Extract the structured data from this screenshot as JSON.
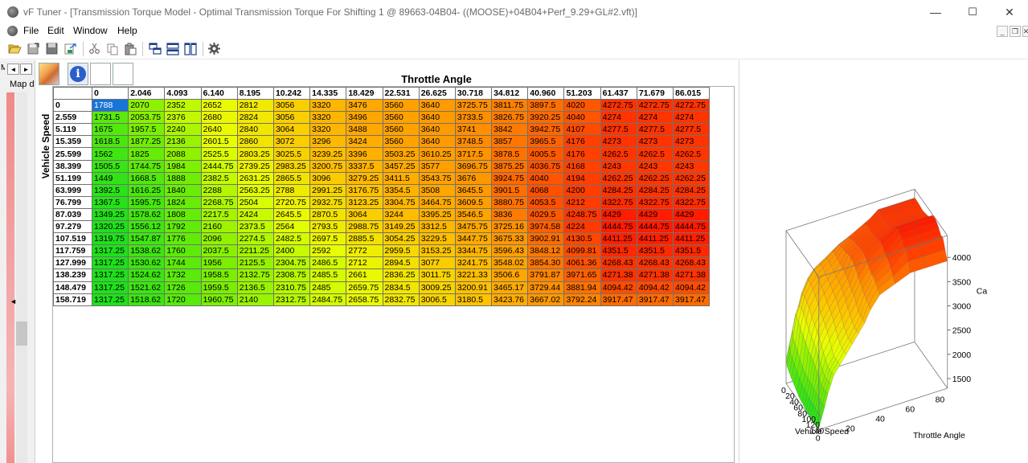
{
  "window": {
    "title": "vF Tuner  - [Transmission Torque Model - Optimal Transmission Torque For Shifting 1 @ 89663-04B04- ((MOOSE)+04B04+Perf_9.29+GL#2.vft)]",
    "minimize": "—",
    "maximize": "☐",
    "close": "✕"
  },
  "menu": {
    "items": [
      "File",
      "Edit",
      "Window",
      "Help"
    ],
    "mdi_minimize": "_",
    "mdi_restore": "❐",
    "mdi_close": "✕"
  },
  "sidebar": {
    "stub": "M",
    "label": "Map d",
    "left_arrow": "◄",
    "right_arrow": "►",
    "marker": "◄"
  },
  "grid": {
    "title": "Throttle Angle",
    "ylabel": "Vehicle Speed",
    "columns": [
      "0",
      "2.046",
      "4.093",
      "6.140",
      "8.195",
      "10.242",
      "14.335",
      "18.429",
      "22.531",
      "26.625",
      "30.718",
      "34.812",
      "40.960",
      "51.203",
      "61.437",
      "71.679",
      "86.015"
    ],
    "rows": [
      {
        "label": "0",
        "values": [
          "1788",
          "2070",
          "2352",
          "2652",
          "2812",
          "3056",
          "3320",
          "3476",
          "3560",
          "3640",
          "3725.75",
          "3811.75",
          "3897.5",
          "4020",
          "4272.75",
          "4272.75",
          "4272.75"
        ]
      },
      {
        "label": "2.559",
        "values": [
          "1731.5",
          "2053.75",
          "2376",
          "2680",
          "2824",
          "3056",
          "3320",
          "3496",
          "3560",
          "3640",
          "3733.5",
          "3826.75",
          "3920.25",
          "4040",
          "4274",
          "4274",
          "4274"
        ]
      },
      {
        "label": "5.119",
        "values": [
          "1675",
          "1957.5",
          "2240",
          "2640",
          "2840",
          "3064",
          "3320",
          "3488",
          "3560",
          "3640",
          "3741",
          "3842",
          "3942.75",
          "4107",
          "4277.5",
          "4277.5",
          "4277.5"
        ]
      },
      {
        "label": "15.359",
        "values": [
          "1618.5",
          "1877.25",
          "2136",
          "2601.5",
          "2860",
          "3072",
          "3296",
          "3424",
          "3560",
          "3640",
          "3748.5",
          "3857",
          "3965.5",
          "4176",
          "4273",
          "4273",
          "4273"
        ]
      },
      {
        "label": "25.599",
        "values": [
          "1562",
          "1825",
          "2088",
          "2525.5",
          "2803.25",
          "3025.5",
          "3239.25",
          "3396",
          "3503.25",
          "3610.25",
          "3717.5",
          "3878.5",
          "4005.5",
          "4176",
          "4262.5",
          "4262.5",
          "4262.5"
        ]
      },
      {
        "label": "38.399",
        "values": [
          "1505.5",
          "1744.75",
          "1984",
          "2444.75",
          "2739.25",
          "2983.25",
          "3200.75",
          "3337.5",
          "3457.25",
          "3577",
          "3696.75",
          "3875.25",
          "4036.75",
          "4168",
          "4243",
          "4243",
          "4243"
        ]
      },
      {
        "label": "51.199",
        "values": [
          "1449",
          "1668.5",
          "1888",
          "2382.5",
          "2631.25",
          "2865.5",
          "3096",
          "3279.25",
          "3411.5",
          "3543.75",
          "3676",
          "3924.75",
          "4040",
          "4194",
          "4262.25",
          "4262.25",
          "4262.25"
        ]
      },
      {
        "label": "63.999",
        "values": [
          "1392.5",
          "1616.25",
          "1840",
          "2288",
          "2563.25",
          "2788",
          "2991.25",
          "3176.75",
          "3354.5",
          "3508",
          "3645.5",
          "3901.5",
          "4068",
          "4200",
          "4284.25",
          "4284.25",
          "4284.25"
        ]
      },
      {
        "label": "76.799",
        "values": [
          "1367.5",
          "1595.75",
          "1824",
          "2268.75",
          "2504",
          "2720.75",
          "2932.75",
          "3123.25",
          "3304.75",
          "3464.75",
          "3609.5",
          "3880.75",
          "4053.5",
          "4212",
          "4322.75",
          "4322.75",
          "4322.75"
        ]
      },
      {
        "label": "87.039",
        "values": [
          "1349.25",
          "1578.62",
          "1808",
          "2217.5",
          "2424",
          "2645.5",
          "2870.5",
          "3064",
          "3244",
          "3395.25",
          "3546.5",
          "3836",
          "4029.5",
          "4248.75",
          "4429",
          "4429",
          "4429"
        ]
      },
      {
        "label": "97.279",
        "values": [
          "1320.25",
          "1556.12",
          "1792",
          "2160",
          "2373.5",
          "2564",
          "2793.5",
          "2988.75",
          "3149.25",
          "3312.5",
          "3475.75",
          "3725.16",
          "3974.58",
          "4224",
          "4444.75",
          "4444.75",
          "4444.75"
        ]
      },
      {
        "label": "107.519",
        "values": [
          "1319.75",
          "1547.87",
          "1776",
          "2096",
          "2274.5",
          "2482.5",
          "2697.5",
          "2885.5",
          "3054.25",
          "3229.5",
          "3447.75",
          "3675.33",
          "3902.91",
          "4130.5",
          "4411.25",
          "4411.25",
          "4411.25"
        ]
      },
      {
        "label": "117.759",
        "values": [
          "1317.25",
          "1538.62",
          "1760",
          "2037.5",
          "2211.25",
          "2400",
          "2592",
          "2772",
          "2959.5",
          "3153.25",
          "3344.75",
          "3596.43",
          "3848.12",
          "4099.81",
          "4351.5",
          "4351.5",
          "4351.5"
        ]
      },
      {
        "label": "127.999",
        "values": [
          "1317.25",
          "1530.62",
          "1744",
          "1956",
          "2125.5",
          "2304.75",
          "2486.5",
          "2712",
          "2894.5",
          "3077",
          "3241.75",
          "3548.02",
          "3854.30",
          "4061.36",
          "4268.43",
          "4268.43",
          "4268.43"
        ]
      },
      {
        "label": "138.239",
        "values": [
          "1317.25",
          "1524.62",
          "1732",
          "1958.5",
          "2132.75",
          "2308.75",
          "2485.5",
          "2661",
          "2836.25",
          "3011.75",
          "3221.33",
          "3506.6",
          "3791.87",
          "3971.65",
          "4271.38",
          "4271.38",
          "4271.38"
        ]
      },
      {
        "label": "148.479",
        "values": [
          "1317.25",
          "1521.62",
          "1726",
          "1959.5",
          "2136.5",
          "2310.75",
          "2485",
          "2659.75",
          "2834.5",
          "3009.25",
          "3200.91",
          "3465.17",
          "3729.44",
          "3881.94",
          "4094.42",
          "4094.42",
          "4094.42"
        ]
      },
      {
        "label": "158.719",
        "values": [
          "1317.25",
          "1518.62",
          "1720",
          "1960.75",
          "2140",
          "2312.75",
          "2484.75",
          "2658.75",
          "2832.75",
          "3006.5",
          "3180.5",
          "3423.76",
          "3667.02",
          "3792.24",
          "3917.47",
          "3917.47",
          "3917.47"
        ]
      }
    ]
  },
  "plot": {
    "z_ticks": [
      "4000",
      "3500",
      "3000",
      "2500",
      "2000",
      "1500"
    ],
    "z_label_stub": "Ca",
    "speed_ticks": [
      "0",
      "20",
      "40",
      "60",
      "80",
      "100",
      "120",
      "140"
    ],
    "throttle_ticks": [
      "0",
      "20",
      "40",
      "60",
      "80"
    ],
    "speed_label": "Vehicle Speed",
    "throttle_label": "Throttle Angle"
  }
}
